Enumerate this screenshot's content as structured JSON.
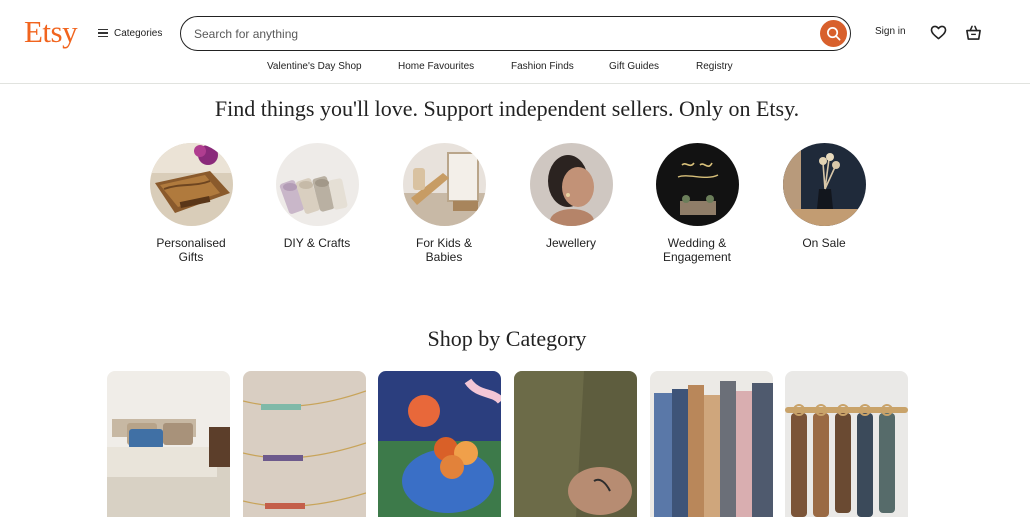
{
  "header": {
    "logo": "Etsy",
    "categories_label": "Categories",
    "search_placeholder": "Search for anything",
    "signin_label": "Sign in"
  },
  "subnav": [
    "Valentine's Day Shop",
    "Home Favourites",
    "Fashion Finds",
    "Gift Guides",
    "Registry"
  ],
  "hero": {
    "headline": "Find things you'll love. Support independent sellers. Only on Etsy."
  },
  "circle_categories": [
    {
      "line1": "Personalised",
      "line2": "Gifts"
    },
    {
      "line1": "DIY & Crafts",
      "line2": ""
    },
    {
      "line1": "For Kids &",
      "line2": "Babies"
    },
    {
      "line1": "Jewellery",
      "line2": ""
    },
    {
      "line1": "Wedding &",
      "line2": "Engagement"
    },
    {
      "line1": "On Sale",
      "line2": ""
    }
  ],
  "shop_by_category": {
    "heading": "Shop by Category"
  },
  "colors": {
    "brand": "#f1641e",
    "search_button": "#d8602c",
    "text": "#222222",
    "divider": "#e1e3df"
  },
  "icons": [
    "hamburger-icon",
    "search-icon",
    "heart-icon",
    "shopping-bag-icon"
  ]
}
